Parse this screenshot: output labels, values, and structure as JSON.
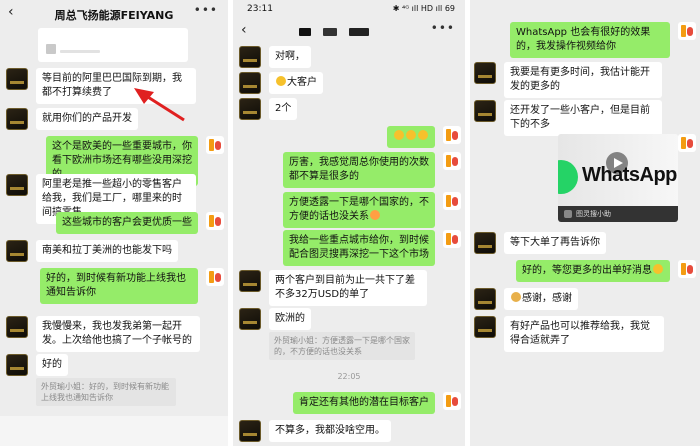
{
  "panel1": {
    "title": "周总飞扬能源FEIYANG",
    "messages": {
      "m1": "等目前的阿里巴巴国际到期，我都不打算续费了",
      "m2": "就用你们的产品开发",
      "m3": "这个是欧美的一些重要城市，你看下欧洲市场还有哪些没用深挖的",
      "m4": "阿里老是推一些超小的零售客户给我，我们是工厂，哪里来的时间搞零售",
      "m5": "这些城市的客户会更优质一些",
      "m6": "南美和拉丁美洲的也能发下吗",
      "m7": "好的，到时候有新功能上线我也通知告诉你",
      "m8": "我慢慢来，我也发我弟第一起开发。上次给他也搞了一个子帐号的",
      "m9": "好的"
    },
    "quote": "外贸瑜小姐：好的，到时候有新功能上线我也通知告诉你"
  },
  "panel2": {
    "status_time": "23:11",
    "status_icons": "✱ ⁴ᴳ ıll HD ıll 69",
    "messages": {
      "m1": "对啊，",
      "m2": "大客户",
      "m3": "2个",
      "m5": "厉害，我感觉周总你使用的次数都不算是很多的",
      "m6": "方便透露一下是哪个国家的，不方便的话也没关系",
      "m7": "我给一些重点城市给你，到时候配合图灵搜再深挖一下这个市场",
      "m8": "两个客户到目前为止一共下了差不多32万USD的单了",
      "m9": "欧洲的",
      "m10": "肯定还有其他的潜在目标客户",
      "m11": "不算多，我都没啥空用。"
    },
    "quote": "外贸瑜小姐：方便透露一下是哪个国家的，不方便的话也没关系",
    "timestamp": "22:05"
  },
  "panel3": {
    "messages": {
      "m1": "WhatsApp 也会有很好的效果的，我发操作视频给你",
      "m2": "我要是有更多时间，我估计能开发的更多的",
      "m3": "还开发了一些小客户，但是目前下的不多",
      "m5": "等下大单了再告诉你",
      "m6": "好的，等您更多的出单好消息",
      "m7": "感谢，感谢",
      "m8": "有好产品也可以推荐给我，我觉得合适就弄了"
    },
    "video": {
      "word": "WhatsApp",
      "caption": "图灵搜小助"
    }
  },
  "colors": {
    "outgoing_bubble": "#95ec69",
    "incoming_bubble": "#ffffff",
    "chat_bg": "#ededed",
    "annotation_arrow": "#e02020"
  }
}
